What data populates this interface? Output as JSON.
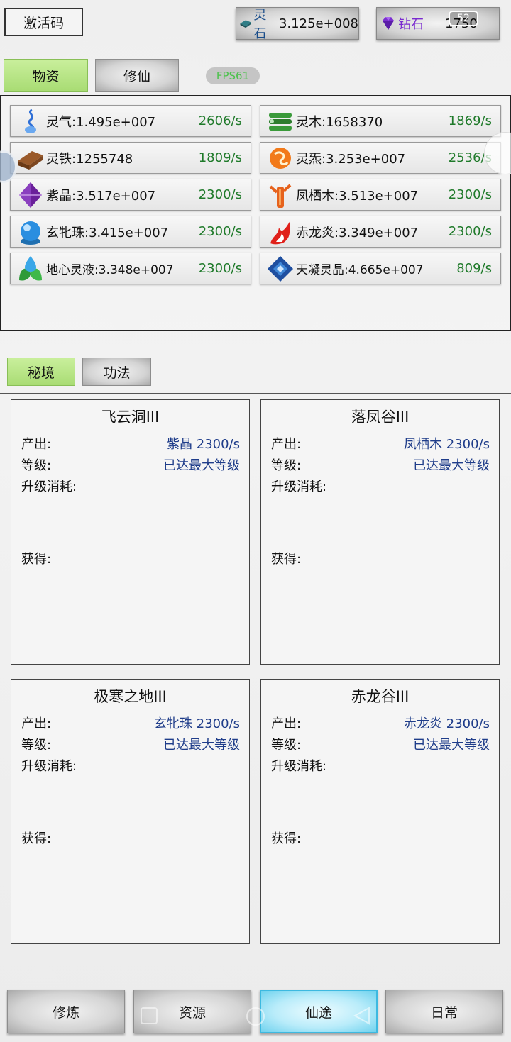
{
  "header": {
    "activate_label": "激活码",
    "stone_label": "灵石",
    "stone_value": "3.125e+008",
    "diamond_label": "钻石",
    "diamond_value": "1750",
    "status_time": "52"
  },
  "tabs_top": [
    {
      "label": "物资",
      "active": true
    },
    {
      "label": "修仙",
      "active": false
    }
  ],
  "fps": "FPS61",
  "resources": [
    {
      "name": "灵气:1.495e+007",
      "rate": "2606/s",
      "icon": "spirit-qi-icon"
    },
    {
      "name": "灵木:1658370",
      "rate": "1869/s",
      "icon": "spirit-wood-icon"
    },
    {
      "name": "灵铁:1255748",
      "rate": "1809/s",
      "icon": "spirit-iron-icon"
    },
    {
      "name": "灵炁:3.253e+007",
      "rate": "2536/s",
      "icon": "spirit-fire-qi-icon"
    },
    {
      "name": "紫晶:3.517e+007",
      "rate": "2300/s",
      "icon": "purple-crystal-icon"
    },
    {
      "name": "凤栖木:3.513e+007",
      "rate": "2300/s",
      "icon": "phoenix-wood-icon"
    },
    {
      "name": "玄牝珠:3.415e+007",
      "rate": "2300/s",
      "icon": "mystic-pearl-icon"
    },
    {
      "name": "赤龙炎:3.349e+007",
      "rate": "2300/s",
      "icon": "red-dragon-flame-icon"
    },
    {
      "name": "地心灵液:3.348e+007",
      "rate": "2300/s",
      "icon": "earth-spirit-liquid-icon"
    },
    {
      "name": "天凝灵晶:4.665e+007",
      "rate": "809/s",
      "icon": "sky-crystal-icon"
    }
  ],
  "tabs_mid": [
    {
      "label": "秘境",
      "active": true
    },
    {
      "label": "功法",
      "active": false
    }
  ],
  "realm_labels": {
    "output": "产出:",
    "level": "等级:",
    "cost": "升级消耗:",
    "gain": "获得:"
  },
  "realms": [
    {
      "name": "飞云洞III",
      "output": "紫晶 2300/s",
      "level": "已达最大等级"
    },
    {
      "name": "落凤谷III",
      "output": "凤栖木 2300/s",
      "level": "已达最大等级"
    },
    {
      "name": "极寒之地III",
      "output": "玄牝珠 2300/s",
      "level": "已达最大等级"
    },
    {
      "name": "赤龙谷III",
      "output": "赤龙炎 2300/s",
      "level": "已达最大等级"
    }
  ],
  "bottom_nav": [
    {
      "label": "修炼",
      "active": false
    },
    {
      "label": "资源",
      "active": false
    },
    {
      "label": "仙途",
      "active": true
    },
    {
      "label": "日常",
      "active": false
    }
  ],
  "colors": {
    "accent_green": "#a9dc74",
    "rate_green": "#1f7a2a",
    "realm_value_blue": "#1f3d8a",
    "stone_label": "#1a4d8a",
    "diamond_label": "#7a2ad0",
    "active_nav": "#6fd2ee"
  }
}
